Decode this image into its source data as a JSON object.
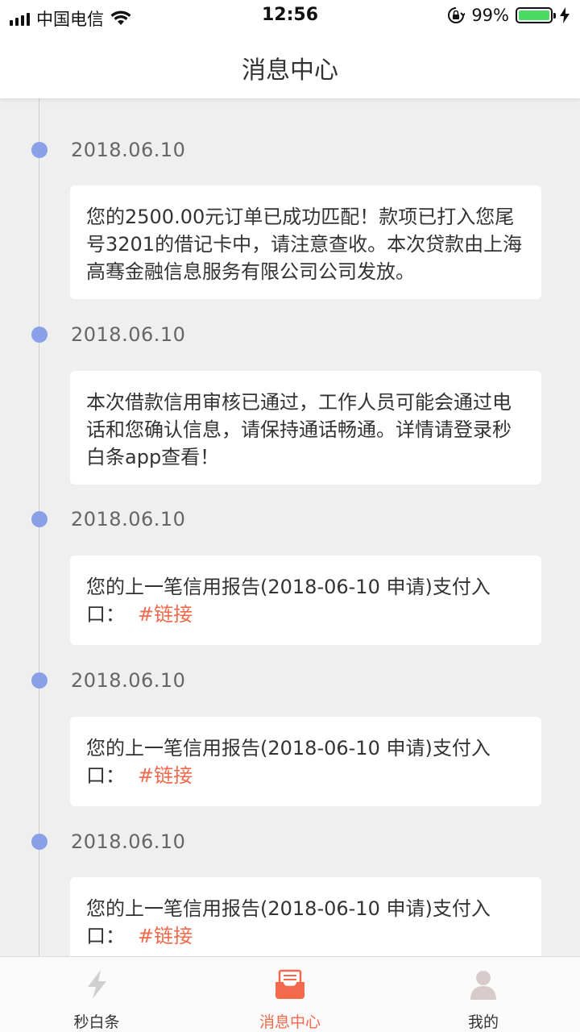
{
  "status_bar": {
    "carrier": "中国电信",
    "time": "12:56",
    "battery_percent": "99%",
    "battery_level": 0.99
  },
  "header": {
    "title": "消息中心"
  },
  "messages": [
    {
      "date": "2018.06.10",
      "text": "您的2500.00元订单已成功匹配！款项已打入您尾号3201的借记卡中，请注意查收。本次贷款由上海高骞金融信息服务有限公司公司发放。",
      "link": ""
    },
    {
      "date": "2018.06.10",
      "text": "本次借款信用审核已通过，工作人员可能会通过电话和您确认信息，请保持通话畅通。详情请登录秒白条app查看！",
      "link": ""
    },
    {
      "date": "2018.06.10",
      "text": "您的上一笔信用报告(2018-06-10 申请)支付入口：",
      "link": "#链接"
    },
    {
      "date": "2018.06.10",
      "text": "您的上一笔信用报告(2018-06-10 申请)支付入口：",
      "link": "#链接"
    },
    {
      "date": "2018.06.10",
      "text": "您的上一笔信用报告(2018-06-10 申请)支付入口：",
      "link": "#链接"
    }
  ],
  "tabbar": {
    "tabs": [
      {
        "label": "秒白条",
        "icon": "lightning-icon",
        "active": false
      },
      {
        "label": "消息中心",
        "icon": "message-inbox-icon",
        "active": true
      },
      {
        "label": "我的",
        "icon": "user-profile-icon",
        "active": false
      }
    ]
  },
  "colors": {
    "accent": "#f26a4b",
    "timeline_dot": "#8aa0e8",
    "battery_green": "#4cd964",
    "background": "#efefef"
  }
}
